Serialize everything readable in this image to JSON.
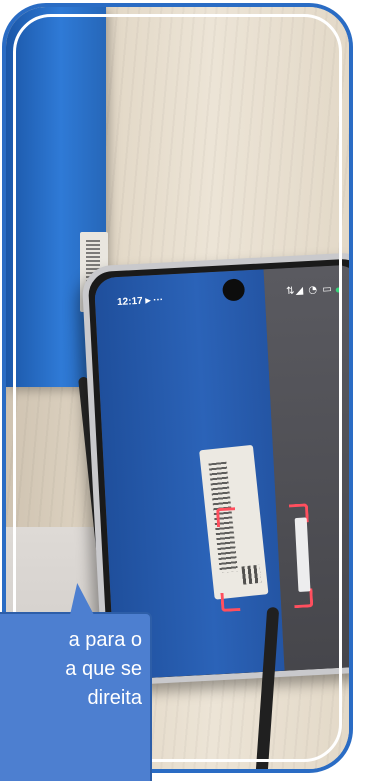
{
  "phone": {
    "status_time": "12:17",
    "status_extra": "▸ ···",
    "status_icons": "⇅◢ ◔ ▭"
  },
  "callout": {
    "lines": [
      "a para o",
      "a que se",
      "direita"
    ]
  },
  "colors": {
    "frame": "#2a6cc4",
    "callout": "#4d7fd0",
    "scan_corner": "#ff4f5e",
    "device_blue": "#2b63b8"
  }
}
